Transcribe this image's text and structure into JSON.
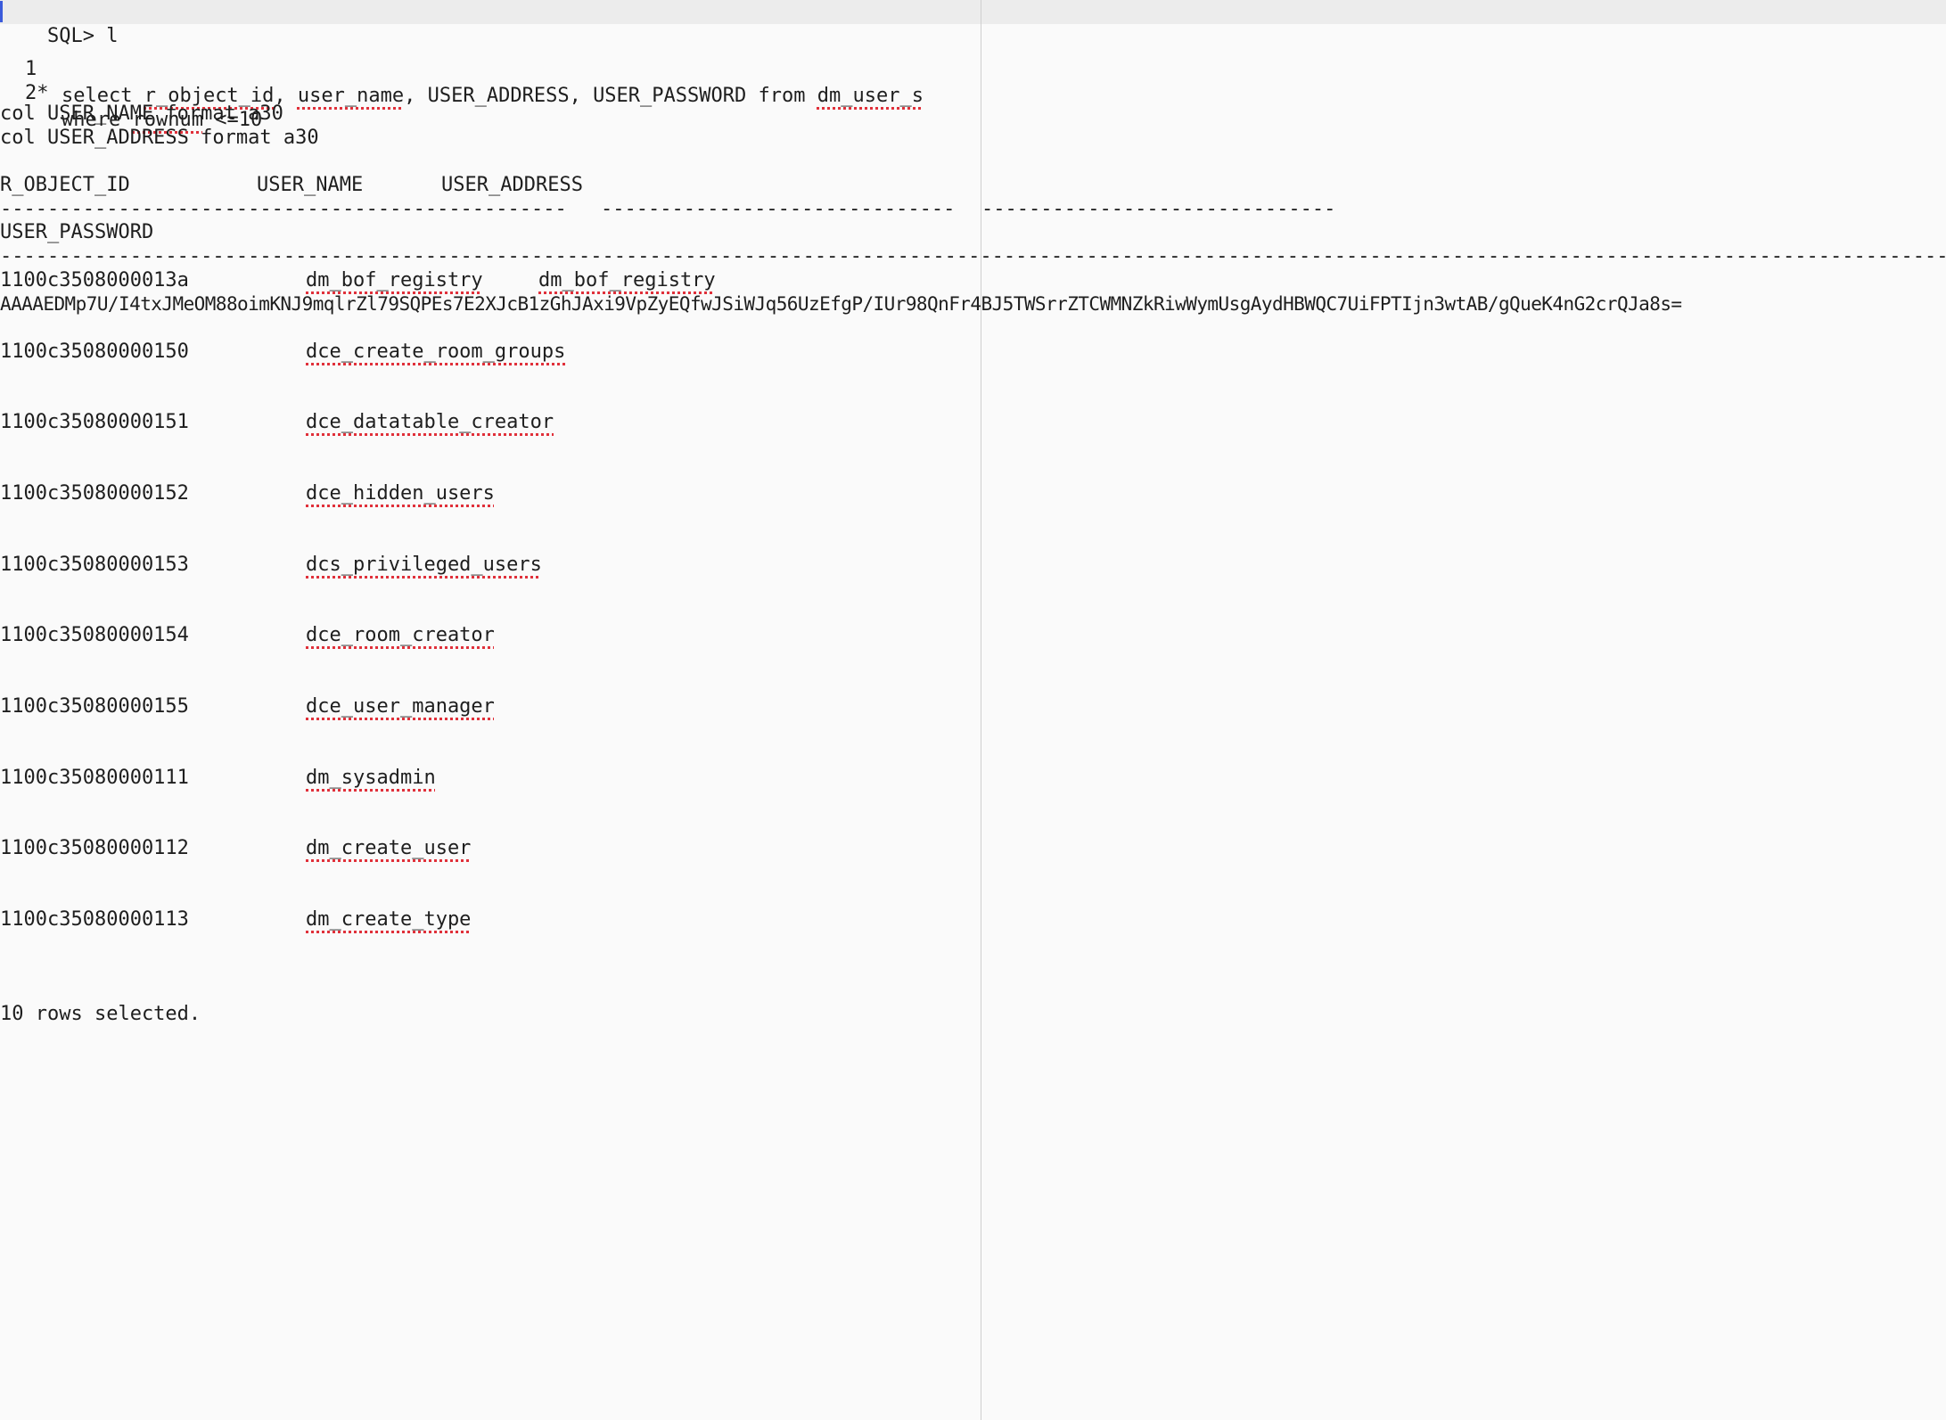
{
  "prompt": {
    "text": "SQL> l"
  },
  "query": {
    "line1_num": "1",
    "line1_pre": "select ",
    "line1_rid": "r_object_id",
    "line1_mid": ", ",
    "line1_uname": "user_name",
    "line1_post": ", USER_ADDRESS, USER_PASSWORD from ",
    "line1_table": "dm_user_s",
    "line2_num": "2*",
    "line2_pre": "where ",
    "line2_rownum": "rownum",
    "line2_post": " <=10"
  },
  "formats": [
    "col USER_NAME format a30",
    "col USER_ADDRESS format a30"
  ],
  "headers": {
    "r_object_id": "R_OBJECT_ID",
    "user_name": "USER_NAME",
    "user_address": "USER_ADDRESS",
    "user_password": "USER_PASSWORD"
  },
  "separators": {
    "col1": "------------------------------------------------",
    "col2": "------------------------------",
    "col3": "------------------------------",
    "password": "-----------------------------------------------------------------------------------------------------------------------------------------------------------------------------------------------------------"
  },
  "rows": [
    {
      "r_object_id": "1100c3508000013a",
      "user_name": "dm_bof_registry",
      "user_address": "dm_bof_registry",
      "user_password": "AAAAEDMp7U/I4txJMeOM88oimKNJ9mqlrZl79SQPEs7E2XJcB1zGhJAxi9VpZyEQfwJSiWJq56UzEfgP/IUr98QnFr4BJ5TWSrrZTCWMNZkRiwWymUsgAydHBWQC7UiFPTIjn3wtAB/gQueK4nG2crQJa8s="
    },
    {
      "r_object_id": "1100c35080000150",
      "user_name": "dce_create_room_groups"
    },
    {
      "r_object_id": "1100c35080000151",
      "user_name": "dce_datatable_creator"
    },
    {
      "r_object_id": "1100c35080000152",
      "user_name": "dce_hidden_users"
    },
    {
      "r_object_id": "1100c35080000153",
      "user_name": "dcs_privileged_users"
    },
    {
      "r_object_id": "1100c35080000154",
      "user_name": "dce_room_creator"
    },
    {
      "r_object_id": "1100c35080000155",
      "user_name": "dce_user_manager"
    },
    {
      "r_object_id": "1100c35080000111",
      "user_name": "dm_sysadmin"
    },
    {
      "r_object_id": "1100c35080000112",
      "user_name": "dm_create_user"
    },
    {
      "r_object_id": "1100c35080000113",
      "user_name": "dm_create_type"
    }
  ],
  "footer": {
    "text": "10 rows selected."
  }
}
